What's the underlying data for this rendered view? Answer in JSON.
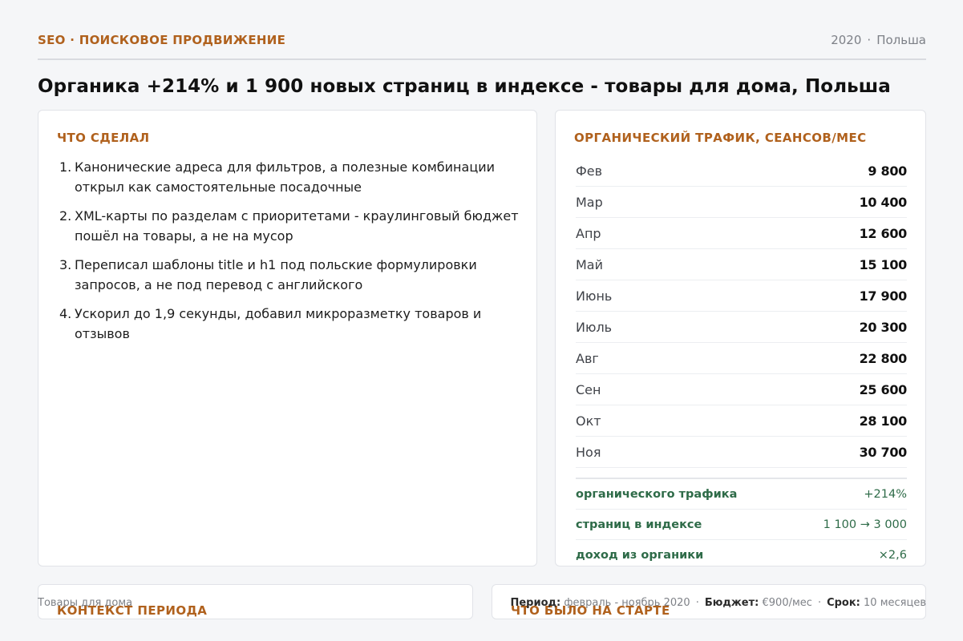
{
  "header": {
    "kicker": "SEO · ПОИСКОВОЕ ПРОДВИЖЕНИЕ",
    "year": "2020",
    "country": "Польша"
  },
  "title": "Органика +214% и 1 900 новых страниц в индексе - товары для дома, Польша",
  "done": {
    "heading": "ЧТО СДЕЛАЛ",
    "items": [
      {
        "num": "1.",
        "text": "Канонические адреса для фильтров, а полезные комбинации открыл как самостоятельные посадочные"
      },
      {
        "num": "2.",
        "text": "XML-карты по разделам с приоритетами - краулинговый бюджет пошёл на товары, а не на мусор"
      },
      {
        "num": "3.",
        "text": "Переписал шаблоны title и h1 под польские формулировки запросов, а не под перевод с английского"
      },
      {
        "num": "4.",
        "text": "Ускорил до 1,9 секунды, добавил микроразметку товаров и отзывов"
      }
    ]
  },
  "traffic": {
    "heading": "ОРГАНИЧЕСКИЙ ТРАФИК, СЕАНСОВ/МЕС",
    "rows": [
      {
        "month": "Фев",
        "value": "9 800"
      },
      {
        "month": "Мар",
        "value": "10 400"
      },
      {
        "month": "Апр",
        "value": "12 600"
      },
      {
        "month": "Май",
        "value": "15 100"
      },
      {
        "month": "Июнь",
        "value": "17 900"
      },
      {
        "month": "Июль",
        "value": "20 300"
      },
      {
        "month": "Авг",
        "value": "22 800"
      },
      {
        "month": "Сен",
        "value": "25 600"
      },
      {
        "month": "Окт",
        "value": "28 100"
      },
      {
        "month": "Ноя",
        "value": "30 700"
      }
    ],
    "results": [
      {
        "label": "органического трафика",
        "value": "+214%"
      },
      {
        "label": "страниц в индексе",
        "value": "1 100 → 3 000"
      },
      {
        "label": "доход из органики",
        "value": "×2,6"
      }
    ]
  },
  "context": {
    "heading": "КОНТЕКСТ ПЕРИОДА"
  },
  "start": {
    "heading": "ЧТО БЫЛО НА СТАРТЕ"
  },
  "footer": {
    "category": "Товары для дома",
    "period_label": "Период:",
    "period": "февраль - ноябрь 2020",
    "budget_label": "Бюджет:",
    "budget": "€900/мес",
    "term_label": "Срок:",
    "term": "10 месяцев"
  }
}
